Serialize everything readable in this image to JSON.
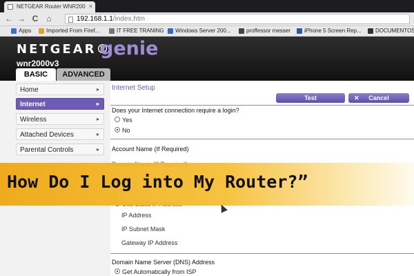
{
  "browser": {
    "tab_title": "NETGEAR Router WNR200",
    "tab_close": "×",
    "nav_back": "←",
    "nav_forward": "→",
    "nav_reload": "C",
    "nav_home": "⌂",
    "url_host": "192.168.1.1",
    "url_path": "/index.htm",
    "bookmarks": [
      {
        "label": "Apps",
        "icon_color": "#3a6fd8"
      },
      {
        "label": "Imported From Firef...",
        "icon_color": "#e0a22a"
      },
      {
        "label": "IT FREE TRANING",
        "icon_color": "#777777"
      },
      {
        "label": "Windows Server 200...",
        "icon_color": "#2a6cc8"
      },
      {
        "label": "proffessor messer",
        "icon_color": "#444444"
      },
      {
        "label": "iPhone 5 Screen Rep...",
        "icon_color": "#3355aa"
      },
      {
        "label": "DOCUMENTOS",
        "icon_color": "#333333"
      }
    ]
  },
  "header": {
    "brand": "NETGEAR®",
    "product": "genie",
    "model": "wnr2000v3",
    "tabs": {
      "basic": "BASIC",
      "advanced": "ADVANCED"
    }
  },
  "sidebar": {
    "items": [
      {
        "label": "Home",
        "active": false
      },
      {
        "label": "Internet",
        "active": true
      },
      {
        "label": "Wireless",
        "active": false
      },
      {
        "label": "Attached Devices",
        "active": false
      },
      {
        "label": "Parental Controls",
        "active": false
      }
    ],
    "arrow": "▸"
  },
  "main": {
    "title": "Internet Setup",
    "test_button": "Test",
    "cancel_button": "Cancel",
    "cancel_icon": "✕",
    "login_question": "Does your Internet connection require a login?",
    "login_yes": "Yes",
    "login_no": "No",
    "account_name": "Account Name  (If Required)",
    "domain_name": "Domain Name  (If Required)",
    "ip_static_option": "Use Static IP Address",
    "ip_address": "IP Address",
    "ip_subnet": "IP Subnet Mask",
    "gateway_ip": "Gateway IP Address",
    "dns_title": "Domain Name Server (DNS) Address",
    "dns_auto": "Get Automatically from ISP"
  },
  "overlay": {
    "headline": "How Do I Log into My Router?”"
  },
  "colors": {
    "accent_purple": "#6d5bb5",
    "banner_orange": "#efa814"
  }
}
